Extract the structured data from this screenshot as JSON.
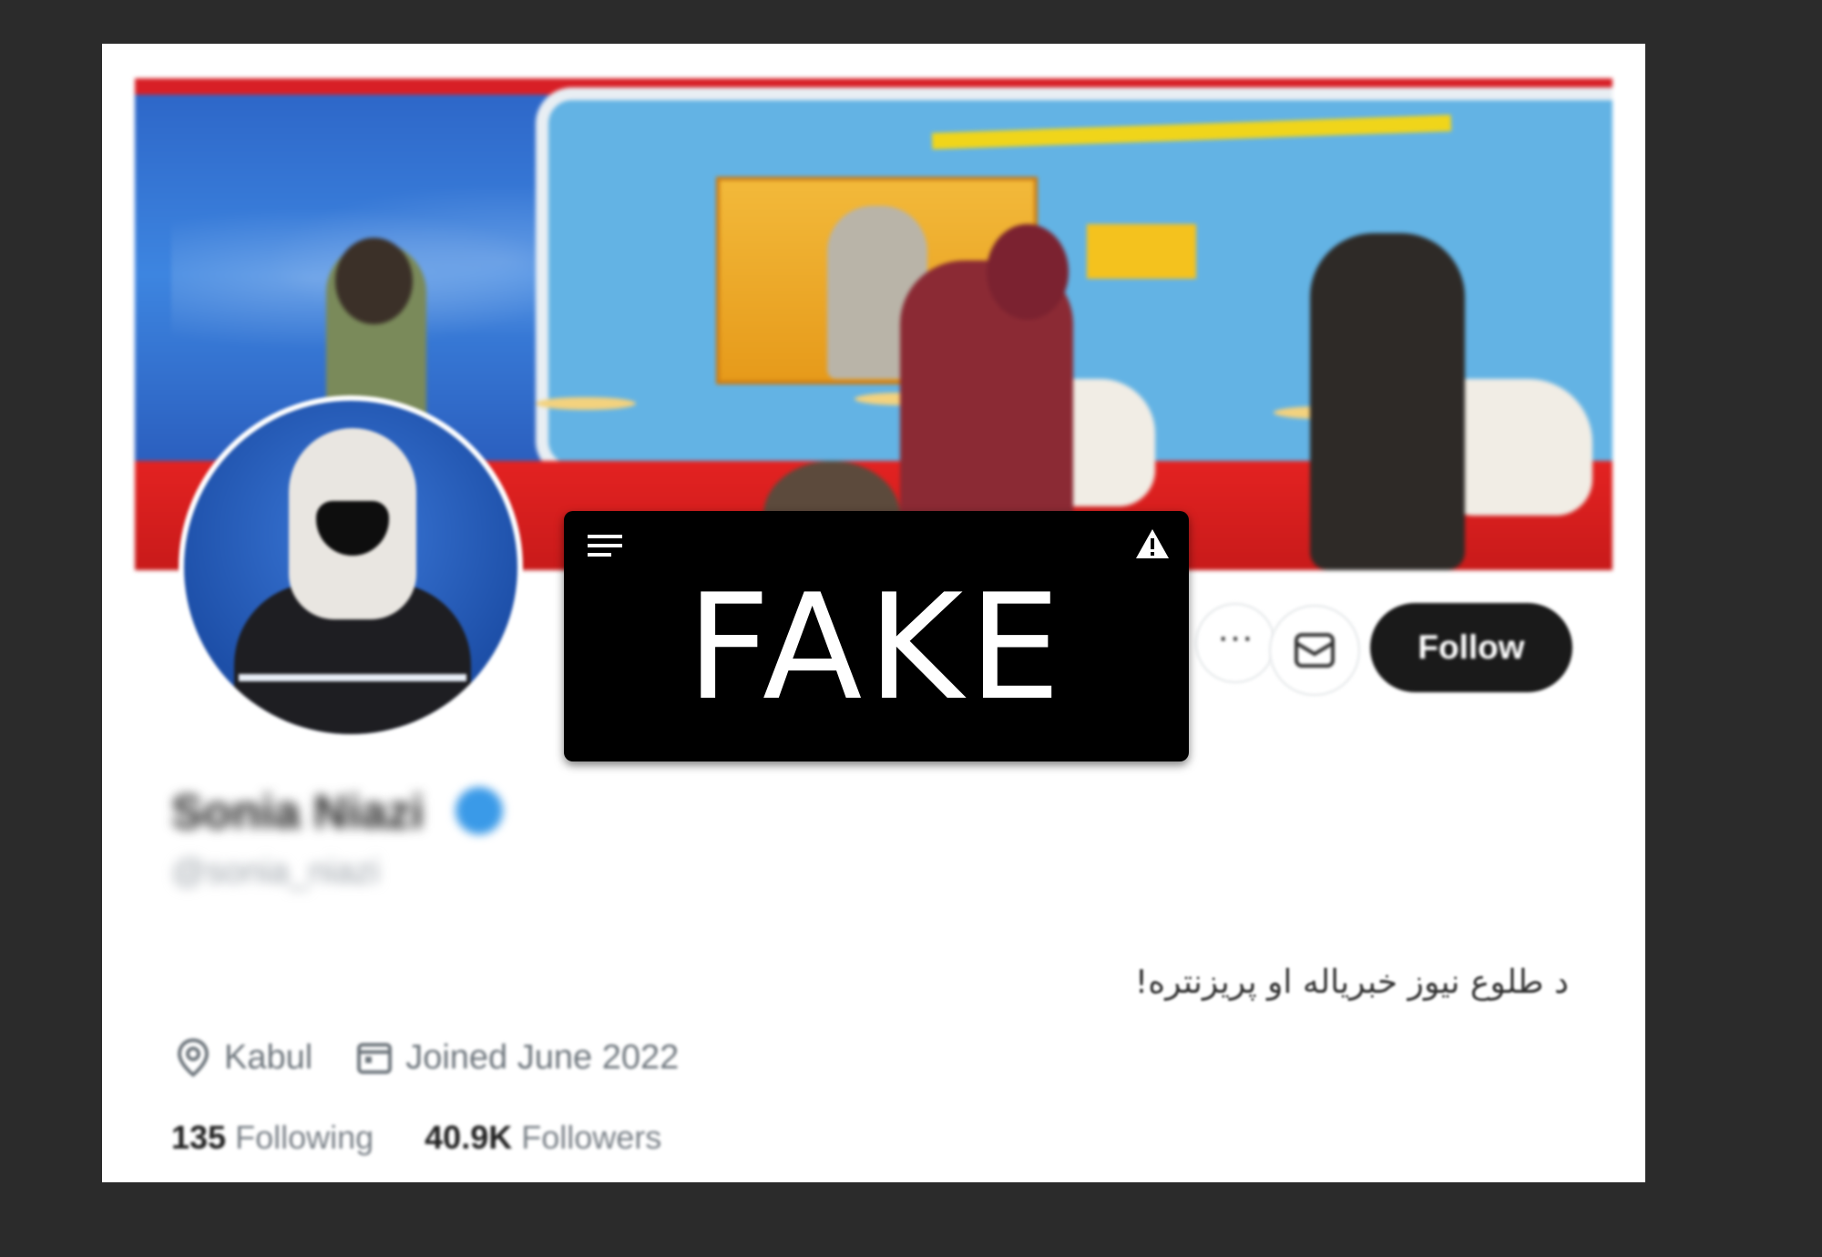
{
  "profile": {
    "name": "Sonia Niazi",
    "handle": "@sonia_niazi",
    "verified": true,
    "bio": "د طلوع نیوز خبریاله او پریزنتره!",
    "location": "Kabul",
    "joined": "Joined June 2022",
    "following_count": "135",
    "following_label": "Following",
    "followers_count": "40.9K",
    "followers_label": "Followers"
  },
  "actions": {
    "more_label": "···",
    "follow_label": "Follow"
  },
  "overlay": {
    "label": "FAKE"
  },
  "colors": {
    "page_bg": "#2b2b2b",
    "follow_button": "#1a1a1a",
    "verified_badge": "#3a9ae8",
    "overlay_bg": "#000000"
  },
  "icons": [
    "location-pin-icon",
    "calendar-icon",
    "mail-icon",
    "more-icon",
    "menu-icon",
    "warning-icon",
    "verified-badge-icon"
  ]
}
